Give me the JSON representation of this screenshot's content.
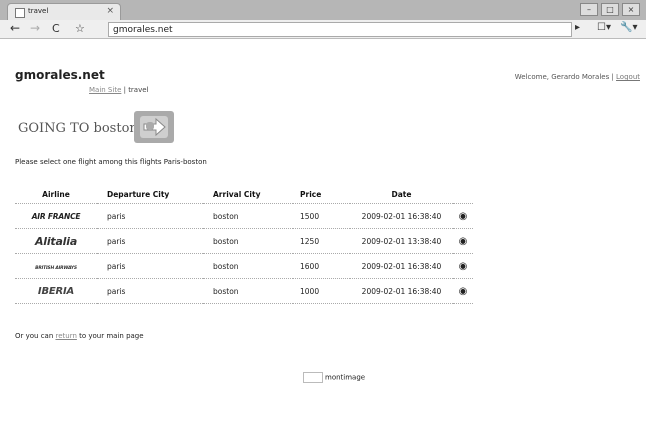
{
  "browser": {
    "tab_title": "travel",
    "tab_close": "×",
    "window_buttons": [
      "–",
      "□",
      "×"
    ],
    "nav": {
      "back": "←",
      "forward": "→",
      "reload": "C",
      "star": "☆"
    },
    "address": {
      "host": "gmorales.net"
    },
    "toolbar_right": {
      "play": "▸",
      "page": "☐▾",
      "wrench": "🔧▾"
    }
  },
  "site": {
    "title": "gmorales.net"
  },
  "breadcrumb": {
    "link": "Main Site",
    "separator": " | ",
    "current": "travel"
  },
  "welcome": {
    "text": "Welcome, Gerardo Morales | ",
    "logout": "Logout"
  },
  "going": {
    "text": "GOING TO boston"
  },
  "select_text": "Please select one flight among this flights Paris-boston",
  "table": {
    "headers": [
      "Airline",
      "Departure City",
      "Arrival City",
      "Price",
      "Date",
      ""
    ],
    "rows": [
      {
        "airline": "AIR FRANCE",
        "departure": "paris",
        "arrival": "boston",
        "price": "1500",
        "date": "2009-02-01 16:38:40",
        "icon": "◉"
      },
      {
        "airline": "Alitalia",
        "departure": "paris",
        "arrival": "boston",
        "price": "1250",
        "date": "2009-02-01 13:38:40",
        "icon": "◉"
      },
      {
        "airline": "BRITISH AIRWAYS",
        "departure": "paris",
        "arrival": "boston",
        "price": "1600",
        "date": "2009-02-01 16:38:40",
        "icon": "◉"
      },
      {
        "airline": "IBERIA",
        "departure": "paris",
        "arrival": "boston",
        "price": "1000",
        "date": "2009-02-01 16:38:40",
        "icon": "◉"
      }
    ]
  },
  "return_line": {
    "before": "Or you can ",
    "link": "return",
    "after": " to your main page"
  },
  "montimage": {
    "text": "montimage"
  }
}
